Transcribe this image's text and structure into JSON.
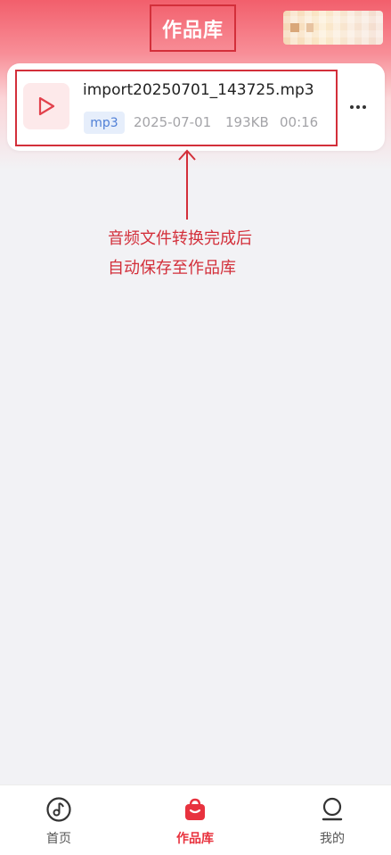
{
  "header": {
    "title": "作品库"
  },
  "card": {
    "file_name": "import20250701_143725.mp3",
    "format_tag": "mp3",
    "date": "2025-07-01",
    "size": "193KB",
    "duration": "00:16"
  },
  "annotation": {
    "line1": "音频文件转换完成后",
    "line2": "自动保存至作品库"
  },
  "tabbar": {
    "items": [
      {
        "label": "首页",
        "icon": "music-note-icon",
        "active": false
      },
      {
        "label": "作品库",
        "icon": "bag-icon",
        "active": true
      },
      {
        "label": "我的",
        "icon": "person-icon",
        "active": false
      }
    ]
  },
  "colors": {
    "accent": "#e8323e",
    "annotation": "#d32f3a",
    "tag_bg": "#e6eefb",
    "tag_text": "#4f7fd6"
  }
}
